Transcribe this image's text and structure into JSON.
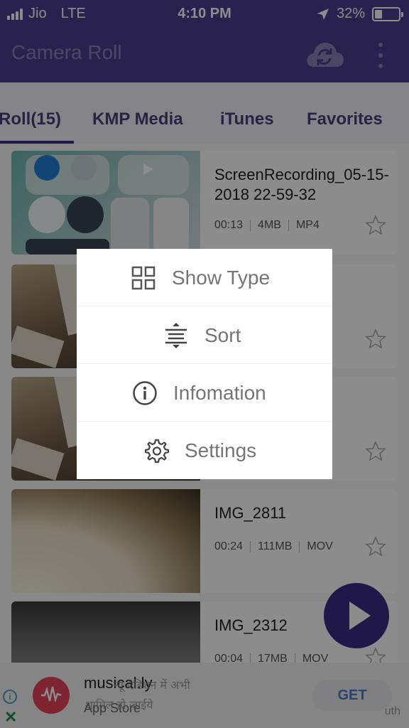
{
  "status_bar": {
    "carrier": "Jio",
    "network": "LTE",
    "time": "4:10 PM",
    "battery": "32%",
    "battery_level": 0.32
  },
  "header": {
    "title": "Camera Roll",
    "cloud_icon": "cloud-sync-icon",
    "menu_icon": "more-vertical-icon"
  },
  "tabs": [
    {
      "label": "Roll(15)",
      "active": true
    },
    {
      "label": "KMP Media"
    },
    {
      "label": "iTunes"
    },
    {
      "label": "Favorites"
    }
  ],
  "items": [
    {
      "name": "ScreenRecording_05-15-2018 22-59-32",
      "duration": "00:13",
      "size": "4MB",
      "format": "MP4"
    },
    {
      "name": "",
      "duration": "",
      "size": "",
      "format": ""
    },
    {
      "name": "",
      "duration": "",
      "size": "",
      "format": ""
    },
    {
      "name": "IMG_2811",
      "duration": "00:24",
      "size": "111MB",
      "format": "MOV"
    },
    {
      "name": "IMG_2312",
      "duration": "00:04",
      "size": "17MB",
      "format": "MOV"
    }
  ],
  "popup_menu": [
    {
      "label": "Show Type",
      "icon": "grid-icon"
    },
    {
      "label": "Sort",
      "icon": "sort-icon"
    },
    {
      "label": "Infomation",
      "icon": "info-icon"
    },
    {
      "label": "Settings",
      "icon": "gear-icon"
    }
  ],
  "ad": {
    "app_name": "musical.ly",
    "store": "App Store",
    "overlay_line1": "न्यू एडिशन में अभी",
    "overlay_line2": "शामिल हो जाईये",
    "cta": "GET",
    "watermark": "uth"
  },
  "colors": {
    "brand": "#4d3f8f",
    "accent": "#3b2d86",
    "tab_text": "#4a3f7f"
  }
}
